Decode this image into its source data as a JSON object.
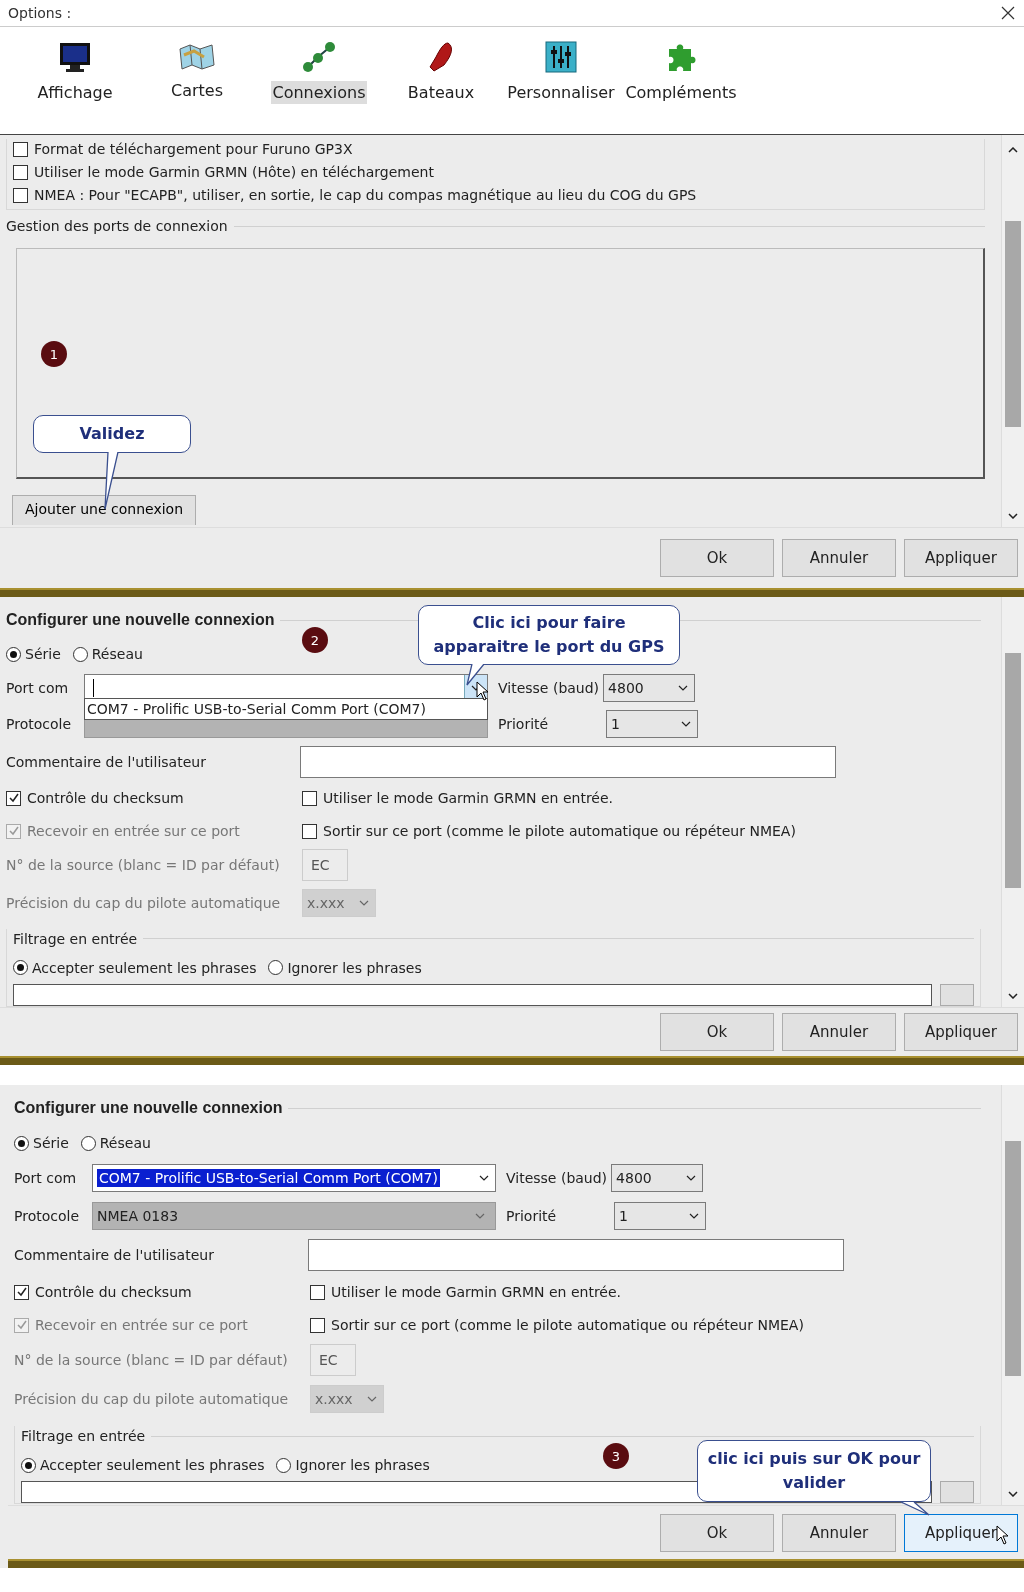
{
  "window": {
    "title": "Options :"
  },
  "toolbar": [
    {
      "label": "Affichage",
      "selected": false
    },
    {
      "label": "Cartes",
      "selected": false
    },
    {
      "label": "Connexions",
      "selected": true
    },
    {
      "label": "Bateaux",
      "selected": false
    },
    {
      "label": "Personnaliser",
      "selected": false
    },
    {
      "label": "Compléments",
      "selected": false
    }
  ],
  "options": [
    {
      "label": "Format de téléchargement pour Furuno GP3X",
      "checked": false
    },
    {
      "label": "Utiliser le mode Garmin GRMN (Hôte) en téléchargement",
      "checked": false
    },
    {
      "label": "NMEA : Pour \"ECAPB\", utiliser, en sortie, le cap du compas magnétique  au lieu du COG du GPS",
      "checked": false
    }
  ],
  "port_manager": {
    "title": "Gestion des ports de connexion",
    "add_button": "Ajouter une connexion",
    "marker": "1",
    "callout": "Validez"
  },
  "buttons": [
    {
      "label": "Ok",
      "hovered": false
    },
    {
      "label": "Annuler",
      "hovered": false
    },
    {
      "label": "Appliquer",
      "hovered": false
    }
  ],
  "config_panels": [
    {
      "title": "Configurer une nouvelle connexion",
      "marker": "2",
      "callout": "Clic ici pour faire apparaitre le port du GPS",
      "connection_types": [
        {
          "label": "Série",
          "selected": true
        },
        {
          "label": "Réseau",
          "selected": false
        }
      ],
      "port_label": "Port com",
      "dropdown_items": [
        "COM7 - Prolific USB-to-Serial Comm Port (COM7)"
      ],
      "speed_label": "Vitesse (baud)",
      "speed_value": "4800",
      "protocol_label": "Protocole",
      "priority_label": "Priorité",
      "priority_value": "1",
      "comment_label": "Commentaire de l'utilisateur",
      "checks": [
        {
          "label": "Contrôle du checksum",
          "checked": true,
          "disabled": false
        },
        {
          "label": "Utiliser le mode Garmin GRMN en entrée.",
          "checked": false,
          "disabled": false
        },
        {
          "label": "Recevoir en entrée sur ce port",
          "checked": true,
          "disabled": true
        },
        {
          "label": "Sortir sur ce port (comme le pilote automatique ou répéteur NMEA)",
          "checked": false,
          "disabled": false
        }
      ],
      "source": {
        "label": "N° de la source (blanc = ID par défaut)",
        "value": "EC",
        "disabled": true
      },
      "precision": {
        "label": "Précision du cap du pilote automatique",
        "value": "x.xxx",
        "disabled": true
      },
      "filter_title": "Filtrage en entrée",
      "filter_options": [
        {
          "label": "Accepter seulement les phrases",
          "selected": true
        },
        {
          "label": "Ignorer les phrases",
          "selected": false
        }
      ],
      "buttons": [
        {
          "label": "Ok",
          "hovered": false
        },
        {
          "label": "Annuler",
          "hovered": false
        },
        {
          "label": "Appliquer",
          "hovered": false
        }
      ]
    },
    {
      "title": "Configurer une nouvelle connexion",
      "marker": "3",
      "callout": "clic ici puis sur OK pour valider",
      "connection_types": [
        {
          "label": "Série",
          "selected": true
        },
        {
          "label": "Réseau",
          "selected": false
        }
      ],
      "port_label": "Port com",
      "port_value": "COM7 - Prolific USB-to-Serial Comm Port (COM7)",
      "port_value_selected": true,
      "speed_label": "Vitesse (baud)",
      "speed_value": "4800",
      "protocol_label": "Protocole",
      "protocol_value": "NMEA 0183",
      "priority_label": "Priorité",
      "priority_value": "1",
      "comment_label": "Commentaire de l'utilisateur",
      "checks": [
        {
          "label": "Contrôle du checksum",
          "checked": true,
          "disabled": false
        },
        {
          "label": "Utiliser le mode Garmin GRMN en entrée.",
          "checked": false,
          "disabled": false
        },
        {
          "label": "Recevoir en entrée sur ce port",
          "checked": true,
          "disabled": true
        },
        {
          "label": "Sortir sur ce port (comme le pilote automatique ou répéteur NMEA)",
          "checked": false,
          "disabled": false
        }
      ],
      "source": {
        "label": "N° de la source (blanc = ID par défaut)",
        "value": "EC",
        "disabled": true
      },
      "precision": {
        "label": "Précision du cap du pilote automatique",
        "value": "x.xxx",
        "disabled": true
      },
      "filter_title": "Filtrage en entrée",
      "filter_options": [
        {
          "label": "Accepter seulement les phrases",
          "selected": true
        },
        {
          "label": "Ignorer les phrases",
          "selected": false
        }
      ],
      "buttons": [
        {
          "label": "Ok",
          "hovered": false
        },
        {
          "label": "Annuler",
          "hovered": false
        },
        {
          "label": "Appliquer",
          "hovered": true
        }
      ]
    }
  ]
}
